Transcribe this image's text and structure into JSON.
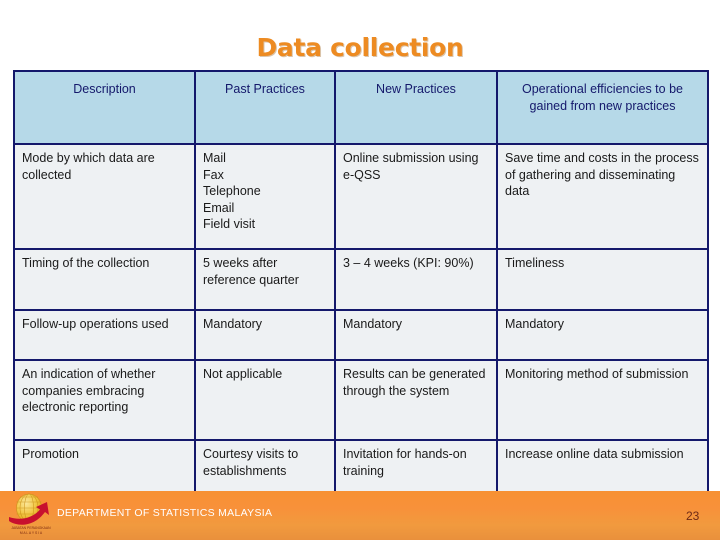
{
  "slide": {
    "title": "Data collection",
    "title_color": "#ED8B22",
    "page_number": "23"
  },
  "table": {
    "border_color": "#14186B",
    "header_bg": "#B6D9E8",
    "header_text_color": "#14186B",
    "cell_bg": "#eef1f3",
    "headers": [
      "Description",
      "Past Practices",
      "New Practices",
      "Operational efficiencies to be gained from new practices"
    ],
    "rows": [
      {
        "description": "Mode by which data are collected",
        "past_practices": "Mail\nFax\nTelephone\nEmail\nField visit",
        "new_practices": "Online submission using e-QSS",
        "operational_efficiencies": "Save time and costs in the process of gathering and disseminating data"
      },
      {
        "description": "Timing of the collection",
        "past_practices": "5 weeks after reference quarter",
        "new_practices": "3 – 4 weeks (KPI: 90%)",
        "operational_efficiencies": "Timeliness"
      },
      {
        "description": "Follow-up operations used",
        "past_practices": "Mandatory",
        "new_practices": "Mandatory",
        "operational_efficiencies": "Mandatory"
      },
      {
        "description": "An indication of whether companies embracing electronic reporting",
        "past_practices": "Not applicable",
        "new_practices": "Results can be generated through the system",
        "operational_efficiencies": "Monitoring method of submission"
      },
      {
        "description": "Promotion",
        "past_practices": "Courtesy visits to establishments",
        "new_practices": "Invitation for hands-on training",
        "operational_efficiencies": "Increase online data submission"
      }
    ]
  },
  "footer": {
    "organization": "DEPARTMENT OF STATISTICS MALAYSIA",
    "logo_caption": "JABATAN PERANGKAAN\nM A L A Y S I A",
    "bar_color": "#F79133",
    "logo_globe_color": "#F2C744",
    "logo_arrow_color": "#C8102E"
  }
}
